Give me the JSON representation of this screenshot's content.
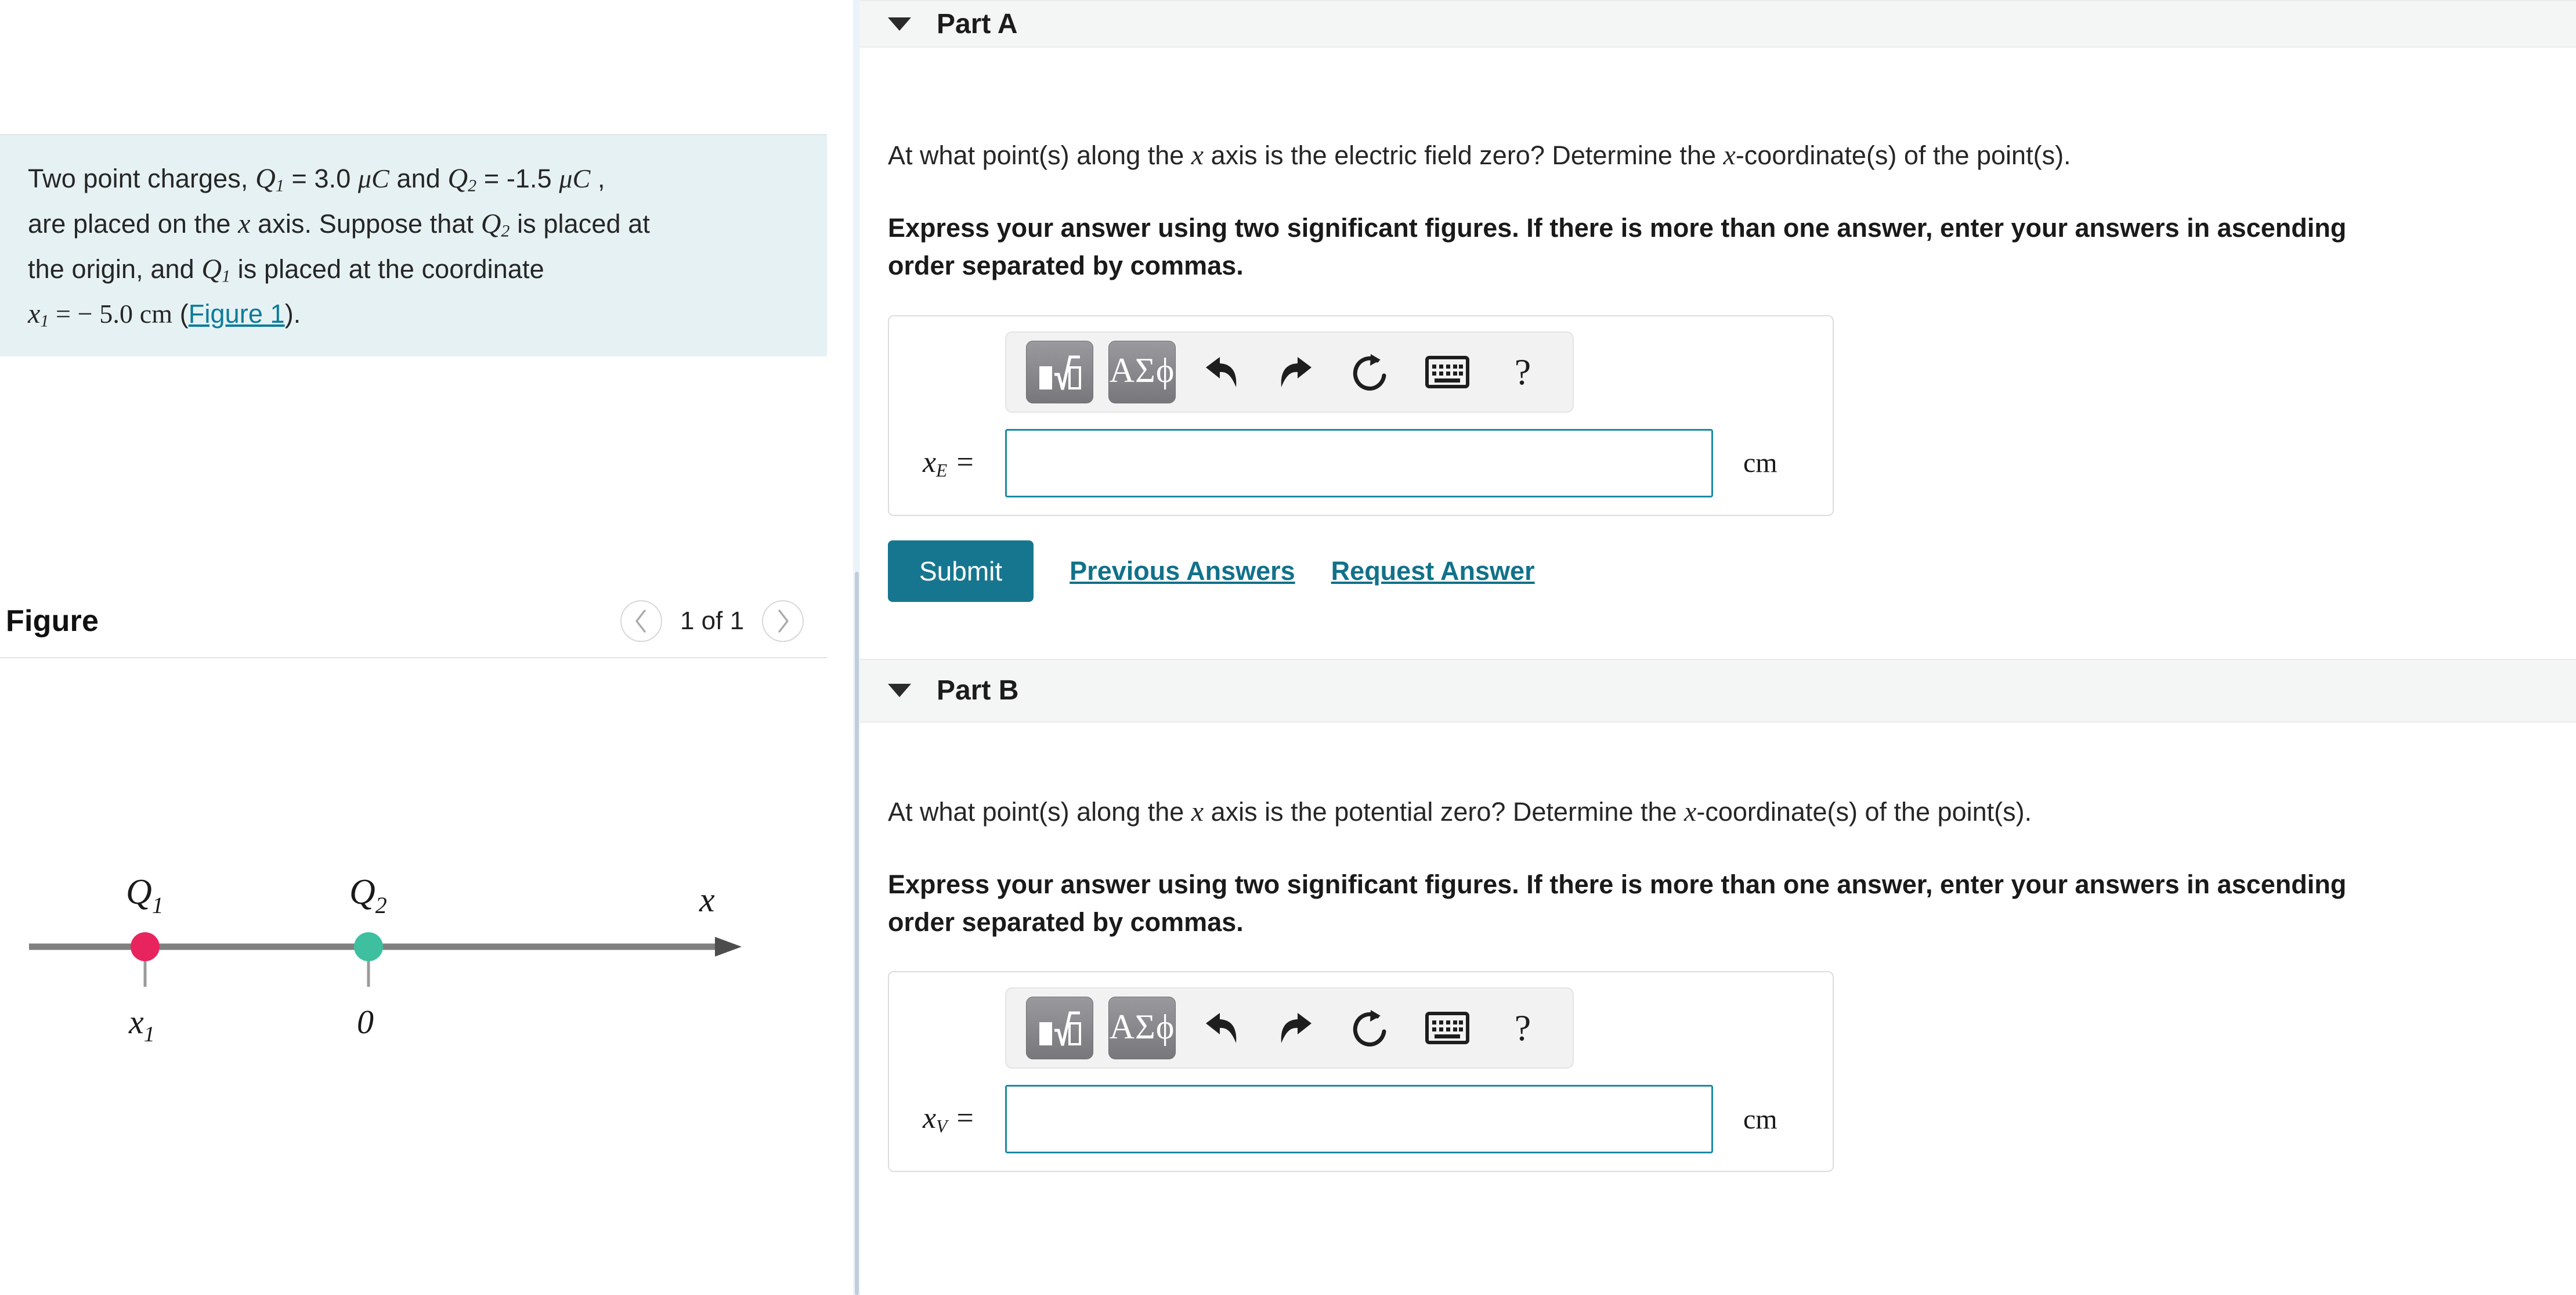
{
  "left_panel": {
    "problem": {
      "line1_a": "Two point charges, ",
      "q1_sym": "Q",
      "q1_sub": "1",
      "eq1": " = 3.0 ",
      "unit1": "μC",
      "and": " and ",
      "q2_sym": "Q",
      "q2_sub": "2",
      "eq2": " = -1.5 ",
      "unit2": "μC",
      "comma": " ,",
      "line2_a": "are placed on the ",
      "x_sym": "x",
      "line2_b": " axis. Suppose that ",
      "q2_sym_b": "Q",
      "q2_sub_b": "2",
      "line2_c": " is placed at",
      "line3_a": "the origin, and ",
      "q1_sym_b": "Q",
      "q1_sub_b": "1",
      "line3_b": " is placed at the coordinate",
      "x1_sym": "x",
      "x1_sub": "1",
      "x1_val": " = − 5.0 ",
      "x1_unit": "cm",
      "paren_open": " (",
      "figure_link": "Figure 1",
      "paren_close": ")."
    },
    "figure": {
      "title": "Figure",
      "prev_icon": "chevron-left-icon",
      "next_icon": "chevron-right-icon",
      "counter": "1 of 1",
      "diagram": {
        "axis_label": "x",
        "charge1_label": "Q",
        "charge1_sub": "1",
        "charge1_tick_label": "x",
        "charge1_tick_sub": "1",
        "charge1_color": "#e8245f",
        "charge2_label": "Q",
        "charge2_sub": "2",
        "charge2_tick_label": "0",
        "charge2_color": "#3dbfa0",
        "axis_color": "#808080"
      }
    }
  },
  "right_panel": {
    "parts": [
      {
        "caret_icon": "caret-down-icon",
        "title": "Part A",
        "question": "At what point(s) along the x axis is the electric field zero? Determine the x-coordinate(s) of the point(s).",
        "question_pre": "At what point(s) along the ",
        "question_x1": "x",
        "question_mid": " axis is the electric field zero? Determine the ",
        "question_x2": "x",
        "question_post": "-coordinate(s) of the point(s).",
        "instruction": "Express your answer using two significant figures. If there is more than one answer, enter your answers in ascending order separated by commas.",
        "toolbar": {
          "template_icon": "math-template-icon",
          "greek_label": "ΑΣϕ",
          "undo_icon": "undo-arrow-icon",
          "redo_icon": "redo-arrow-icon",
          "reset_icon": "reset-circle-icon",
          "keyboard_icon": "keyboard-icon",
          "help_label": "?"
        },
        "answer": {
          "label_var": "x",
          "label_sub": "E",
          "label_eq": " =",
          "value": "",
          "placeholder": "",
          "unit": "cm"
        },
        "actions": {
          "submit": "Submit",
          "previous_answers": "Previous Answers",
          "request_answer": "Request Answer"
        }
      },
      {
        "caret_icon": "caret-down-icon",
        "title": "Part B",
        "question": "At what point(s) along the x axis is the potential zero? Determine the x-coordinate(s) of the point(s).",
        "question_pre": "At what point(s) along the ",
        "question_x1": "x",
        "question_mid": " axis is the potential zero? Determine the ",
        "question_x2": "x",
        "question_post": "-coordinate(s) of the point(s).",
        "instruction": "Express your answer using two significant figures. If there is more than one answer, enter your answers in ascending order separated by commas.",
        "toolbar": {
          "template_icon": "math-template-icon",
          "greek_label": "ΑΣϕ",
          "undo_icon": "undo-arrow-icon",
          "redo_icon": "redo-arrow-icon",
          "reset_icon": "reset-circle-icon",
          "keyboard_icon": "keyboard-icon",
          "help_label": "?"
        },
        "answer": {
          "label_var": "x",
          "label_sub": "V",
          "label_eq": " =",
          "value": "",
          "placeholder": "",
          "unit": "cm"
        }
      }
    ]
  },
  "colors": {
    "accent_teal": "#17768f",
    "link_teal": "#12718a",
    "problem_bg": "#e6f1f3",
    "part_header_bg": "#f4f5f5",
    "input_border": "#1b8aa6",
    "scrollbar_thumb": "#bfcddc"
  }
}
